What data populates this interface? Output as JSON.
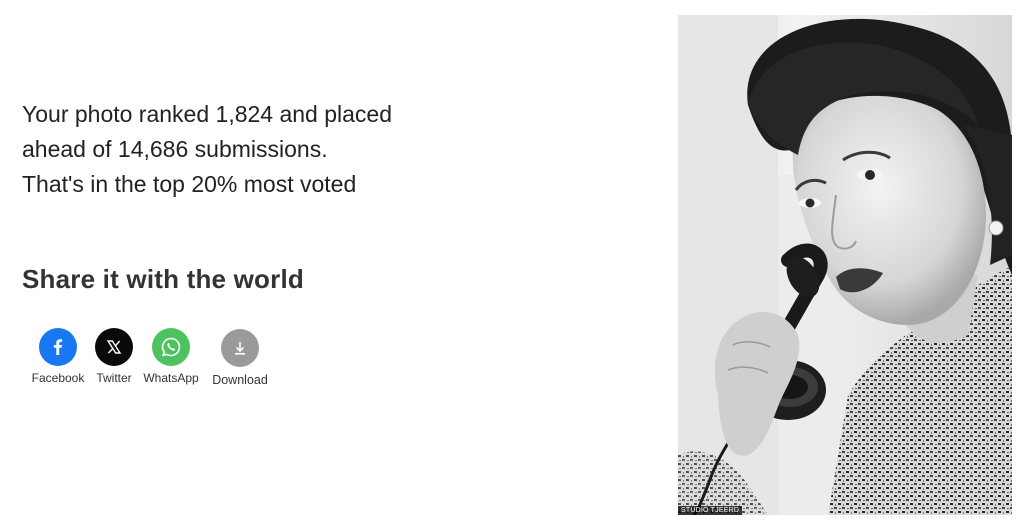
{
  "ranking": {
    "line1": "Your photo ranked 1,824 and placed",
    "line2": "ahead of 14,686 submissions.",
    "line3": "That's in the top 20% most voted"
  },
  "share": {
    "title": "Share it with the world",
    "buttons": [
      {
        "label": "Facebook",
        "icon": "facebook-icon",
        "color": "#1877f2"
      },
      {
        "label": "Twitter",
        "icon": "x-icon",
        "color": "#0a0a0a"
      },
      {
        "label": "WhatsApp",
        "icon": "whatsapp-icon",
        "color": "#4dc35f"
      },
      {
        "label": "Download",
        "icon": "download-icon",
        "color": "#9a9a9a"
      }
    ]
  },
  "photo": {
    "watermark": "STUDIO TJEERD"
  }
}
